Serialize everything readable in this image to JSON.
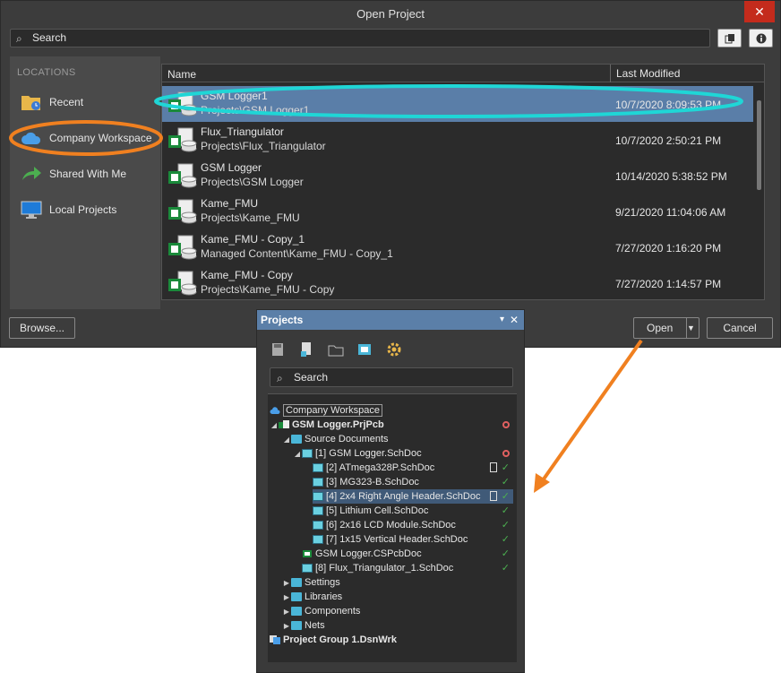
{
  "dialog": {
    "title": "Open Project",
    "close_label": "✕",
    "search_placeholder": "Search",
    "locations_header": "LOCATIONS",
    "locations": [
      {
        "label": "Recent",
        "icon": "folder-clock-icon"
      },
      {
        "label": "Company Workspace",
        "icon": "cloud-icon"
      },
      {
        "label": "Shared With Me",
        "icon": "share-arrow-icon"
      },
      {
        "label": "Local Projects",
        "icon": "monitor-icon"
      }
    ],
    "columns": {
      "name": "Name",
      "modified": "Last Modified"
    },
    "projects": [
      {
        "name": "GSM Logger1",
        "path": "Projects\\GSM Logger1",
        "modified": "10/7/2020 8:09:53 PM",
        "selected": true
      },
      {
        "name": "Flux_Triangulator",
        "path": "Projects\\Flux_Triangulator",
        "modified": "10/7/2020 2:50:21 PM"
      },
      {
        "name": "GSM Logger",
        "path": "Projects\\GSM Logger",
        "modified": "10/14/2020 5:38:52 PM"
      },
      {
        "name": "Kame_FMU",
        "path": "Projects\\Kame_FMU",
        "modified": "9/21/2020 11:04:06 AM"
      },
      {
        "name": "Kame_FMU - Copy_1",
        "path": "Managed Content\\Kame_FMU - Copy_1",
        "modified": "7/27/2020 1:16:20 PM"
      },
      {
        "name": "Kame_FMU - Copy",
        "path": "Projects\\Kame_FMU - Copy",
        "modified": "7/27/2020 1:14:57 PM"
      }
    ],
    "browse_label": "Browse...",
    "open_label": "Open",
    "cancel_label": "Cancel"
  },
  "projects_panel": {
    "title": "Projects",
    "pin_label": "▾",
    "close_label": "✕",
    "search_placeholder": "Search",
    "tree": {
      "workspace": "Company Workspace",
      "project": "GSM Logger.PrjPcb",
      "source_documents": "Source Documents",
      "root_sheet": "[1] GSM Logger.SchDoc",
      "sheets": [
        "[2] ATmega328P.SchDoc",
        "[3] MG323-B.SchDoc",
        "[4] 2x4 Right Angle Header.SchDoc",
        "[5] Lithium Cell.SchDoc",
        "[6] 2x16 LCD Module.SchDoc",
        "[7] 1x15 Vertical Header.SchDoc"
      ],
      "pcb": "GSM Logger.CSPcbDoc",
      "flux_sheet": "[8] Flux_Triangulator_1.SchDoc",
      "folders": [
        "Settings",
        "Libraries",
        "Components",
        "Nets"
      ],
      "group": "Project Group 1.DsnWrk"
    }
  },
  "colors": {
    "accent_cyan": "#1fd6d6",
    "accent_orange": "#f08020",
    "selection": "#5a7ea8"
  }
}
